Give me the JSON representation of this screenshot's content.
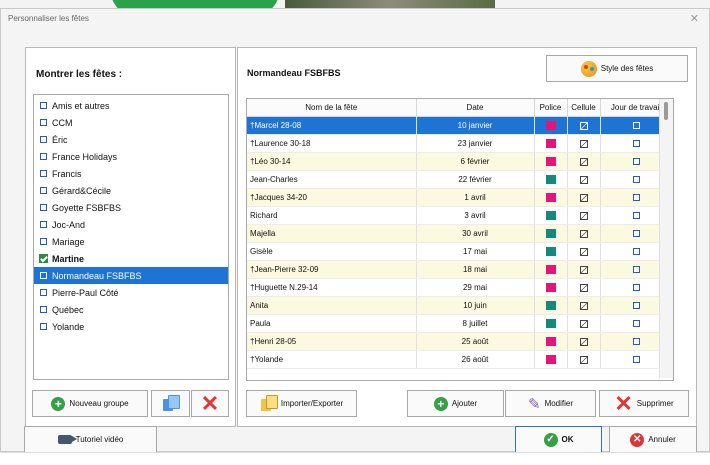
{
  "window": {
    "title": "Personnaliser les fêtes"
  },
  "left_panel": {
    "title": "Montrer les fêtes :",
    "groups": [
      {
        "label": "Amis et autres",
        "checked": false,
        "selected": false
      },
      {
        "label": "CCM",
        "checked": false,
        "selected": false
      },
      {
        "label": "Éric",
        "checked": false,
        "selected": false
      },
      {
        "label": "France Holidays",
        "checked": false,
        "selected": false
      },
      {
        "label": "Francis",
        "checked": false,
        "selected": false
      },
      {
        "label": "Gérard&Cécile",
        "checked": false,
        "selected": false
      },
      {
        "label": "Goyette FSBFBS",
        "checked": false,
        "selected": false
      },
      {
        "label": "Joc-And",
        "checked": false,
        "selected": false
      },
      {
        "label": "Mariage",
        "checked": false,
        "selected": false
      },
      {
        "label": "Martine",
        "checked": true,
        "selected": false
      },
      {
        "label": "Normandeau FSBFBS",
        "checked": false,
        "selected": true
      },
      {
        "label": "Pierre-Paul Côté",
        "checked": false,
        "selected": false
      },
      {
        "label": "Québec",
        "checked": false,
        "selected": false
      },
      {
        "label": "Yolande",
        "checked": false,
        "selected": false
      }
    ],
    "buttons": {
      "new_group": "Nouveau groupe"
    }
  },
  "right_panel": {
    "title": "Normandeau FSBFBS",
    "style_button": "Style des fêtes",
    "table": {
      "headers": [
        "Nom de la fête",
        "Date",
        "Police",
        "Cellule",
        "Jour de travail"
      ],
      "rows": [
        {
          "name": "†Marcel 28-08",
          "date": "10 janvier",
          "color": "#e61478",
          "selected": true,
          "odd": false
        },
        {
          "name": "†Laurence 30-18",
          "date": "23 janvier",
          "color": "#e61478",
          "selected": false,
          "odd": false
        },
        {
          "name": "†Léo 30-14",
          "date": "6 février",
          "color": "#e61478",
          "selected": false,
          "odd": true
        },
        {
          "name": "Jean-Charles",
          "date": "22 février",
          "color": "#168a7a",
          "selected": false,
          "odd": false
        },
        {
          "name": "†Jacques 34-20",
          "date": "1 avril",
          "color": "#e61478",
          "selected": false,
          "odd": true
        },
        {
          "name": "Richard",
          "date": "3 avril",
          "color": "#168a7a",
          "selected": false,
          "odd": false
        },
        {
          "name": "Majella",
          "date": "30 avril",
          "color": "#168a7a",
          "selected": false,
          "odd": true
        },
        {
          "name": "Gisèle",
          "date": "17 mai",
          "color": "#168a7a",
          "selected": false,
          "odd": false
        },
        {
          "name": "†Jean-Pierre 32-09",
          "date": "18 mai",
          "color": "#e61478",
          "selected": false,
          "odd": true
        },
        {
          "name": "†Huguette N.29-14",
          "date": "29 mai",
          "color": "#e61478",
          "selected": false,
          "odd": false
        },
        {
          "name": "Anita",
          "date": "10 juin",
          "color": "#168a7a",
          "selected": false,
          "odd": true
        },
        {
          "name": "Paula",
          "date": "8 juillet",
          "color": "#168a7a",
          "selected": false,
          "odd": false
        },
        {
          "name": "†Henri 28-05",
          "date": "25 août",
          "color": "#e61478",
          "selected": false,
          "odd": true
        },
        {
          "name": "†Yolande",
          "date": "26 août",
          "color": "#e61478",
          "selected": false,
          "odd": false
        }
      ]
    },
    "buttons": {
      "import_export": "Importer/Exporter",
      "add": "Ajouter",
      "modify": "Modifier",
      "delete": "Supprimer"
    }
  },
  "footer": {
    "video_tutorial": "Tutoriel vidéo",
    "ok": "OK",
    "cancel": "Annuler"
  }
}
